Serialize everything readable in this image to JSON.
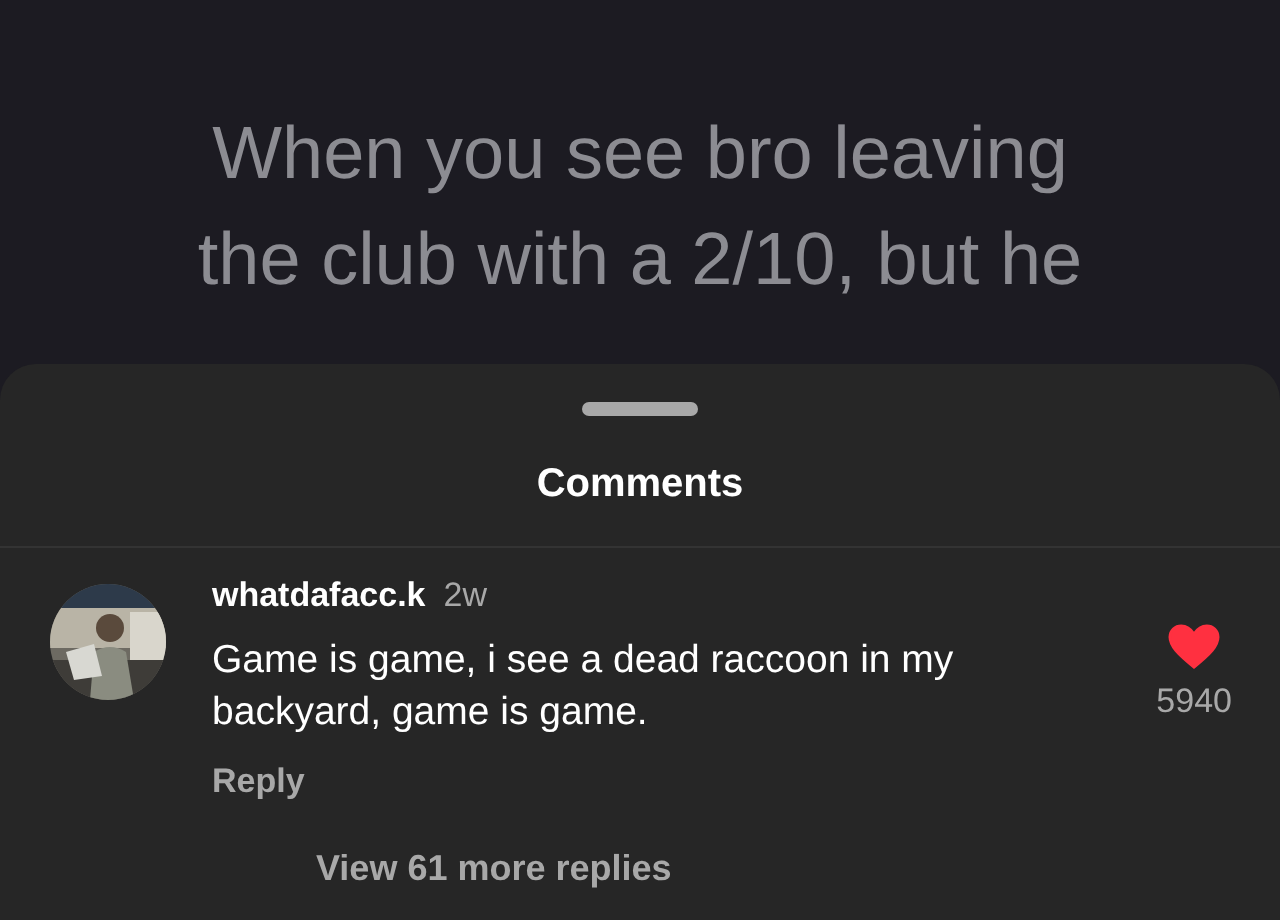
{
  "video": {
    "caption_lines": [
      "When you see bro leaving",
      "the club with a 2/10, but he"
    ]
  },
  "sheet": {
    "title": "Comments",
    "comments": [
      {
        "username": "whatdafacc.k",
        "time": "2w",
        "text": "Game is game, i see a dead raccoon in my backyard, game is game.",
        "reply_label": "Reply",
        "liked": true,
        "like_count": "5940",
        "view_replies": "View 61 more replies"
      }
    ]
  }
}
